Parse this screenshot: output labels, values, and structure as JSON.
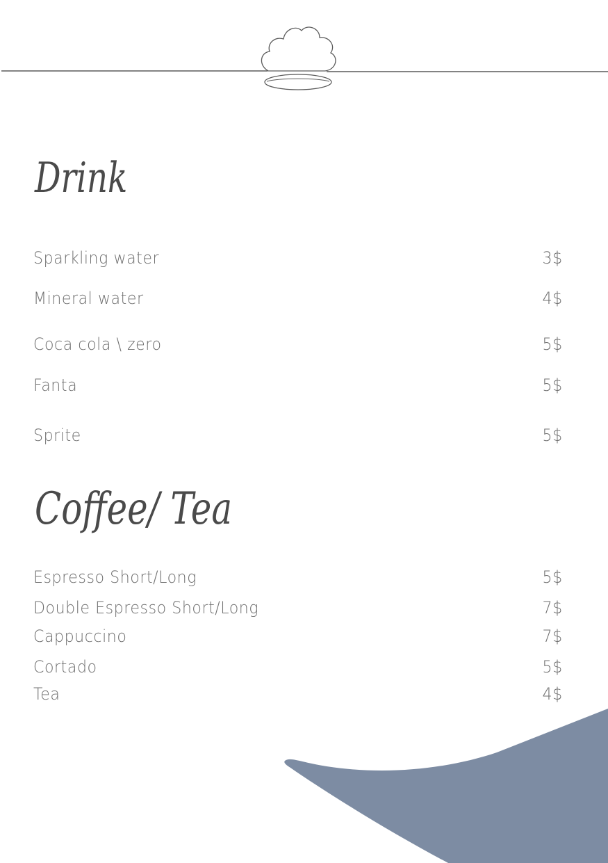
{
  "menu": {
    "sections": [
      {
        "title": "Drink",
        "items": [
          {
            "name": "Sparkling water",
            "price": "3$"
          },
          {
            "name": "Mineral water",
            "price": "4$"
          },
          {
            "name": "Coca cola \\ zero",
            "price": "5$"
          },
          {
            "name": "Fanta",
            "price": "5$"
          },
          {
            "name": "Sprite",
            "price": "5$"
          }
        ]
      },
      {
        "title": "Coffee/ Tea",
        "items": [
          {
            "name": "Espresso Short/Long",
            "price": "5$"
          },
          {
            "name": "Double Espresso Short/Long",
            "price": "7$"
          },
          {
            "name": "Cappuccino",
            "price": "7$"
          },
          {
            "name": "Cortado",
            "price": "5$"
          },
          {
            "name": "Tea",
            "price": "4$"
          }
        ]
      }
    ]
  },
  "decor": {
    "line_color": "#5a5a5a",
    "wave_color": "#7d8ca3",
    "header_icon": "seashell-icon"
  }
}
